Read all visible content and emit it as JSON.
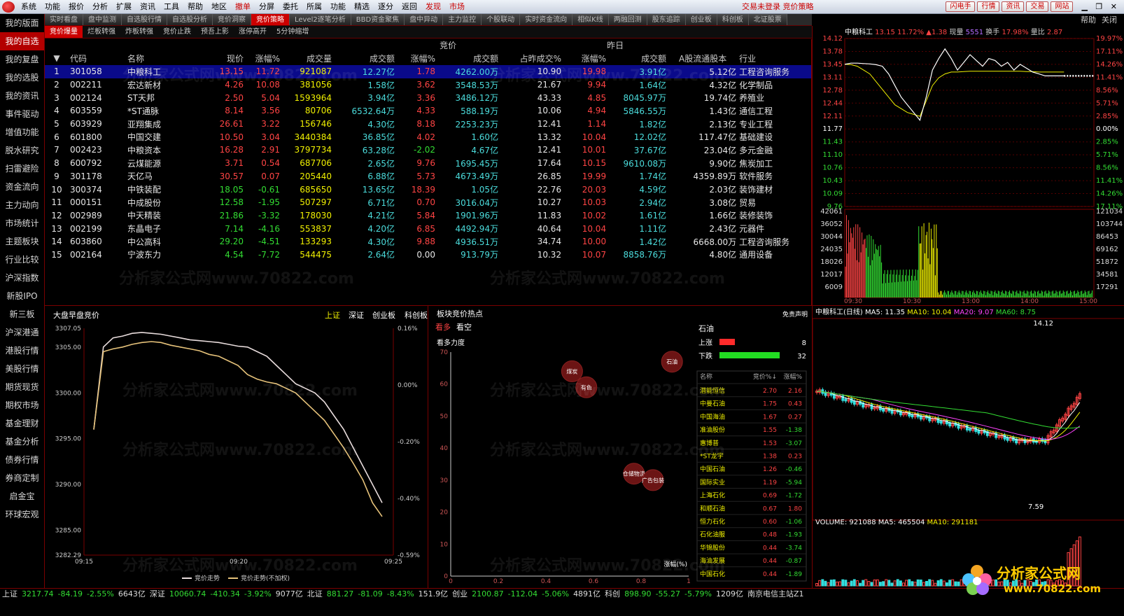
{
  "menubar": {
    "items": [
      "系统",
      "功能",
      "报价",
      "分析",
      "扩展",
      "资讯",
      "工具",
      "帮助",
      "地区",
      "撤单",
      "分屏",
      "委托",
      "所属",
      "功能",
      "精选",
      "逐分",
      "返回",
      "发现",
      "市场"
    ],
    "red_items": [
      "撤单",
      "发现",
      "市场"
    ],
    "status": "交易未登录  竞价策略",
    "buttons": [
      "闪电手",
      "行情",
      "资讯",
      "交易",
      "网站"
    ]
  },
  "sidebar": {
    "items": [
      "我的版面",
      "我的自选",
      "我的复盘",
      "我的选股",
      "我的资讯",
      "事件驱动",
      "增值功能",
      "脱水研究",
      "扫雷避险",
      "资金流向",
      "主力动向",
      "市场统计",
      "主题板块",
      "行业比较",
      "沪深指数",
      "新股IPO",
      "新三板",
      "沪深港通",
      "港股行情",
      "美股行情",
      "期货现货",
      "期权市场",
      "基金理财",
      "基金分析",
      "债券行情",
      "券商定制",
      "启金宝",
      "环球宏观"
    ],
    "active": "我的自选"
  },
  "tabs_top": [
    "实时看盘",
    "盘中监测",
    "自选股行情",
    "自选股分析",
    "竞价洞察",
    "竞价策略",
    "Level2逐笔分析",
    "BBD资金聚焦",
    "盘中异动",
    "主力监控",
    "个股联动",
    "实时资金流向",
    "相似K线",
    "两融回测",
    "股东追踪",
    "创业板",
    "科创板",
    "北证股票"
  ],
  "tabs_top_active": "竞价策略",
  "top_right": [
    "帮助",
    "关闭"
  ],
  "tabs_sub": [
    "竞价爆量",
    "烂板转强",
    "炸板转强",
    "竞价止跌",
    "预吾上影",
    "涨停高开",
    "5分钟缩增"
  ],
  "tabs_sub_active": "竞价爆量",
  "grid": {
    "group_headers": {
      "auction": "竞价",
      "yesterday": "昨日"
    },
    "columns": [
      "",
      "代码",
      "名称",
      "现价",
      "涨幅%",
      "成交量",
      "成交额",
      "涨幅%",
      "成交额",
      "占昨成交%",
      "涨幅%",
      "成交额",
      "A股流通股本",
      "行业"
    ],
    "rows": [
      [
        "1",
        "301058",
        "中粮科工",
        "13.15",
        "11.72",
        "921087",
        "12.27亿",
        "1.78",
        "4262.00万",
        "10.90",
        "19.98",
        "3.91亿",
        "5.12亿",
        "工程咨询服务"
      ],
      [
        "2",
        "002211",
        "宏达新材",
        "4.26",
        "10.08",
        "381056",
        "1.58亿",
        "3.62",
        "3548.53万",
        "21.67",
        "9.94",
        "1.64亿",
        "4.32亿",
        "化学制品"
      ],
      [
        "3",
        "002124",
        "ST天邦",
        "2.50",
        "5.04",
        "1593964",
        "3.94亿",
        "3.36",
        "3486.12万",
        "43.33",
        "4.85",
        "8045.97万",
        "19.74亿",
        "养殖业"
      ],
      [
        "4",
        "603559",
        "*ST通脉",
        "8.14",
        "3.56",
        "80706",
        "6532.64万",
        "4.33",
        "588.19万",
        "10.06",
        "4.94",
        "5846.55万",
        "1.43亿",
        "通信工程"
      ],
      [
        "5",
        "603929",
        "亚翔集成",
        "26.61",
        "3.22",
        "156746",
        "4.30亿",
        "8.18",
        "2253.23万",
        "12.41",
        "1.14",
        "1.82亿",
        "2.13亿",
        "专业工程"
      ],
      [
        "6",
        "601800",
        "中国交建",
        "10.50",
        "3.04",
        "3440384",
        "36.85亿",
        "4.02",
        "1.60亿",
        "13.32",
        "10.04",
        "12.02亿",
        "117.47亿",
        "基础建设"
      ],
      [
        "7",
        "002423",
        "中粮资本",
        "16.28",
        "2.91",
        "3797734",
        "63.28亿",
        "-2.02",
        "4.67亿",
        "12.41",
        "10.01",
        "37.67亿",
        "23.04亿",
        "多元金融"
      ],
      [
        "8",
        "600792",
        "云煤能源",
        "3.71",
        "0.54",
        "687706",
        "2.65亿",
        "9.76",
        "1695.45万",
        "17.64",
        "10.15",
        "9610.08万",
        "9.90亿",
        "焦炭加工"
      ],
      [
        "9",
        "301178",
        "天亿马",
        "30.57",
        "0.07",
        "205440",
        "6.88亿",
        "5.73",
        "4673.49万",
        "26.85",
        "19.99",
        "1.74亿",
        "4359.89万",
        "软件服务"
      ],
      [
        "10",
        "300374",
        "中铁装配",
        "18.05",
        "-0.61",
        "685650",
        "13.65亿",
        "18.39",
        "1.05亿",
        "22.76",
        "20.03",
        "4.59亿",
        "2.03亿",
        "装饰建材"
      ],
      [
        "11",
        "000151",
        "中成股份",
        "12.58",
        "-1.95",
        "507297",
        "6.71亿",
        "0.70",
        "3016.04万",
        "10.27",
        "10.03",
        "2.94亿",
        "3.08亿",
        "贸易"
      ],
      [
        "12",
        "002989",
        "中天精装",
        "21.86",
        "-3.32",
        "178030",
        "4.21亿",
        "5.84",
        "1901.96万",
        "11.83",
        "10.02",
        "1.61亿",
        "1.66亿",
        "装修装饰"
      ],
      [
        "13",
        "002199",
        "东晶电子",
        "7.14",
        "-4.16",
        "553837",
        "4.20亿",
        "6.85",
        "4492.94万",
        "40.64",
        "10.04",
        "1.11亿",
        "2.43亿",
        "元器件"
      ],
      [
        "14",
        "603860",
        "中公高科",
        "29.20",
        "-4.51",
        "133293",
        "4.30亿",
        "9.88",
        "4936.51万",
        "34.74",
        "10.00",
        "1.42亿",
        "6668.00万",
        "工程咨询服务"
      ],
      [
        "15",
        "002164",
        "宁波东力",
        "4.54",
        "-7.72",
        "544475",
        "2.64亿",
        "0.00",
        "913.79万",
        "10.32",
        "10.07",
        "8858.76万",
        "4.80亿",
        "通用设备"
      ]
    ]
  },
  "watermark": "分析家公式网www.70822.com",
  "intraday": {
    "header": {
      "name": "中粮科工",
      "price": "13.15",
      "pct": "11.72%",
      "change": "▲1.38",
      "vol_label": "现量",
      "vol": "5551",
      "turnover_label": "换手",
      "turnover": "17.98%",
      "ratio_label": "量比",
      "ratio": "2.87"
    },
    "price_ticks": [
      "14.12",
      "13.78",
      "13.45",
      "13.11",
      "12.78",
      "12.44",
      "12.11",
      "11.77",
      "11.43",
      "11.10",
      "10.76",
      "10.43",
      "10.09",
      "9.76"
    ],
    "pct_ticks": [
      "19.97%",
      "17.11%",
      "14.26%",
      "11.41%",
      "8.56%",
      "5.71%",
      "2.85%",
      "0.00%",
      "2.85%",
      "5.71%",
      "8.56%",
      "11.41%",
      "14.26%",
      "17.11%"
    ],
    "vol_ticks": [
      "42061",
      "36052",
      "30044",
      "24035",
      "18026",
      "12017",
      "6009"
    ],
    "vol_ticks_r": [
      "121034",
      "103744",
      "86453",
      "69162",
      "51872",
      "34581",
      "17291"
    ],
    "time_ticks": [
      "09:30",
      "10:30",
      "13:00",
      "14:00",
      "15:00"
    ],
    "price_series": [
      13.45,
      13.48,
      13.48,
      13.47,
      13.46,
      13.44,
      13.4,
      13.2,
      12.9,
      12.6,
      12.4,
      12.2,
      12.0,
      12.6,
      13.3,
      13.6,
      13.85,
      13.6,
      13.3,
      13.5,
      13.7,
      13.55,
      13.4,
      13.6,
      13.55,
      13.4,
      13.5,
      13.3,
      13.45,
      13.35,
      13.25,
      13.2,
      13.15,
      13.15,
      13.15,
      13.15
    ],
    "avg_series": [
      13.45,
      13.44,
      13.4,
      13.3,
      13.2,
      13.0,
      12.8,
      12.6,
      12.4,
      12.3,
      12.2,
      12.15,
      12.1,
      12.5,
      12.9,
      13.1,
      13.2,
      13.25,
      13.25,
      13.26,
      13.27,
      13.27,
      13.27,
      13.27,
      13.27,
      13.27,
      13.27,
      13.27,
      13.27,
      13.26,
      13.26,
      13.25,
      13.25,
      13.25,
      13.25,
      13.25
    ]
  },
  "kline": {
    "title": "中粮科工(日线)",
    "ma_labels": [
      {
        "text": "MA5: 11.35",
        "color": "#ffffff"
      },
      {
        "text": "MA10: 10.04",
        "color": "#f0f000"
      },
      {
        "text": "MA20: 9.07",
        "color": "#ff44ff"
      },
      {
        "text": "MA60: 8.75",
        "color": "#33dd33"
      }
    ],
    "high_label": "14.12",
    "low_label": "7.59",
    "volume_label": "VOLUME: 921088",
    "vol_ma5": "MA5: 465504",
    "vol_ma10": "MA10: 291181"
  },
  "auction": {
    "title": "大盘早盘竞价",
    "markets": [
      "上证",
      "深证",
      "创业板",
      "科创板"
    ],
    "active_market": "上证",
    "y_ticks": [
      "3307.05",
      "3305.00",
      "3300.00",
      "3295.00",
      "3290.00",
      "3285.00",
      "3282.29"
    ],
    "pct_ticks": [
      "0.16%",
      "0.00%",
      "-0.20%",
      "-0.40%",
      "-0.59%"
    ],
    "time_ticks": [
      "09:15",
      "09:20",
      "09:25"
    ],
    "legend": [
      "竞价走势",
      "竞价走势(不加权)"
    ],
    "series_weighted": [
      3296,
      3305,
      3306,
      3306.2,
      3306.5,
      3306.6,
      3306.5,
      3306.4,
      3306.2,
      3306,
      3305.8,
      3305.7,
      3305.6,
      3305.5,
      3305.3,
      3305.1,
      3305,
      3304.5,
      3304,
      3303,
      3302,
      3301,
      3300.5,
      3300,
      3299,
      3297.5,
      3296,
      3294,
      3292,
      3290,
      3288
    ],
    "series_unweighted": [
      3296,
      3304.5,
      3304.8,
      3305,
      3305.3,
      3305.5,
      3305.6,
      3305.5,
      3305.2,
      3305,
      3304.8,
      3304.6,
      3304.2,
      3304,
      3303.5,
      3303,
      3302,
      3301.5,
      3301.2,
      3301,
      3300.5,
      3300,
      3299,
      3298,
      3297,
      3295.5,
      3294,
      3292.3,
      3290.5,
      3288,
      3286.5
    ]
  },
  "sector": {
    "title": "板块竞价热点",
    "disclaimer": "免责声明",
    "tabs": [
      "看多",
      "看空"
    ],
    "active_tab": "看多",
    "y_label": "看多力度",
    "x_label": "涨幅(%)",
    "y_ticks": [
      "70",
      "60",
      "50",
      "40",
      "30",
      "20",
      "10",
      "0"
    ],
    "x_ticks": [
      "0",
      "0.2",
      "0.4",
      "0.6",
      "0.8",
      "1"
    ],
    "bubbles": [
      {
        "label": "煤炭",
        "x": 0.51,
        "y": 64
      },
      {
        "label": "有色",
        "x": 0.57,
        "y": 59
      },
      {
        "label": "石油",
        "x": 0.93,
        "y": 67
      },
      {
        "label": "仓储物流",
        "x": 0.77,
        "y": 32
      },
      {
        "label": "广告包装",
        "x": 0.85,
        "y": 30
      }
    ],
    "detail": {
      "name": "石油",
      "up_label": "上涨",
      "up_count": "8",
      "down_label": "下跌",
      "down_count": "32",
      "columns": [
        "名称",
        "竞价%↓",
        "涨幅%"
      ],
      "rows": [
        [
          "潜能恒信",
          "2.70",
          "2.16"
        ],
        [
          "中曼石油",
          "1.75",
          "0.43"
        ],
        [
          "中国海油",
          "1.67",
          "0.27"
        ],
        [
          "准油股份",
          "1.55",
          "-1.38"
        ],
        [
          "惠博普",
          "1.53",
          "-3.07"
        ],
        [
          "*ST龙宇",
          "1.38",
          "0.23"
        ],
        [
          "中国石油",
          "1.26",
          "-0.46"
        ],
        [
          "国际实业",
          "1.19",
          "-5.94"
        ],
        [
          "上海石化",
          "0.69",
          "-1.72"
        ],
        [
          "和顺石油",
          "0.67",
          "1.80"
        ],
        [
          "恒力石化",
          "0.60",
          "-1.06"
        ],
        [
          "石化油服",
          "0.48",
          "-1.93"
        ],
        [
          "华锦股份",
          "0.44",
          "-3.74"
        ],
        [
          "海油发展",
          "0.44",
          "-0.87"
        ],
        [
          "中国石化",
          "0.44",
          "-1.89"
        ]
      ]
    }
  },
  "statusbar": [
    {
      "t": "上证",
      "c": "#ddd"
    },
    {
      "t": "3217.74",
      "c": "#33dd33"
    },
    {
      "t": "-84.19",
      "c": "#33dd33"
    },
    {
      "t": "-2.55%",
      "c": "#33dd33"
    },
    {
      "t": "6643亿",
      "c": "#ddd"
    },
    {
      "t": "深证",
      "c": "#ddd"
    },
    {
      "t": "10060.74",
      "c": "#33dd33"
    },
    {
      "t": "-410.34",
      "c": "#33dd33"
    },
    {
      "t": "-3.92%",
      "c": "#33dd33"
    },
    {
      "t": "9077亿",
      "c": "#ddd"
    },
    {
      "t": "北证",
      "c": "#ddd"
    },
    {
      "t": "881.27",
      "c": "#33dd33"
    },
    {
      "t": "-81.09",
      "c": "#33dd33"
    },
    {
      "t": "-8.43%",
      "c": "#33dd33"
    },
    {
      "t": "151.9亿",
      "c": "#ddd"
    },
    {
      "t": "创业",
      "c": "#ddd"
    },
    {
      "t": "2100.87",
      "c": "#33dd33"
    },
    {
      "t": "-112.04",
      "c": "#33dd33"
    },
    {
      "t": "-5.06%",
      "c": "#33dd33"
    },
    {
      "t": "4891亿",
      "c": "#ddd"
    },
    {
      "t": "科创",
      "c": "#ddd"
    },
    {
      "t": "898.90",
      "c": "#33dd33"
    },
    {
      "t": "-55.27",
      "c": "#33dd33"
    },
    {
      "t": "-5.79%",
      "c": "#33dd33"
    },
    {
      "t": "1209亿",
      "c": "#ddd"
    },
    {
      "t": "南京电信主站Z1",
      "c": "#ddd"
    }
  ],
  "brand": {
    "name": "分析家公式网",
    "url": "www.70822.com"
  }
}
